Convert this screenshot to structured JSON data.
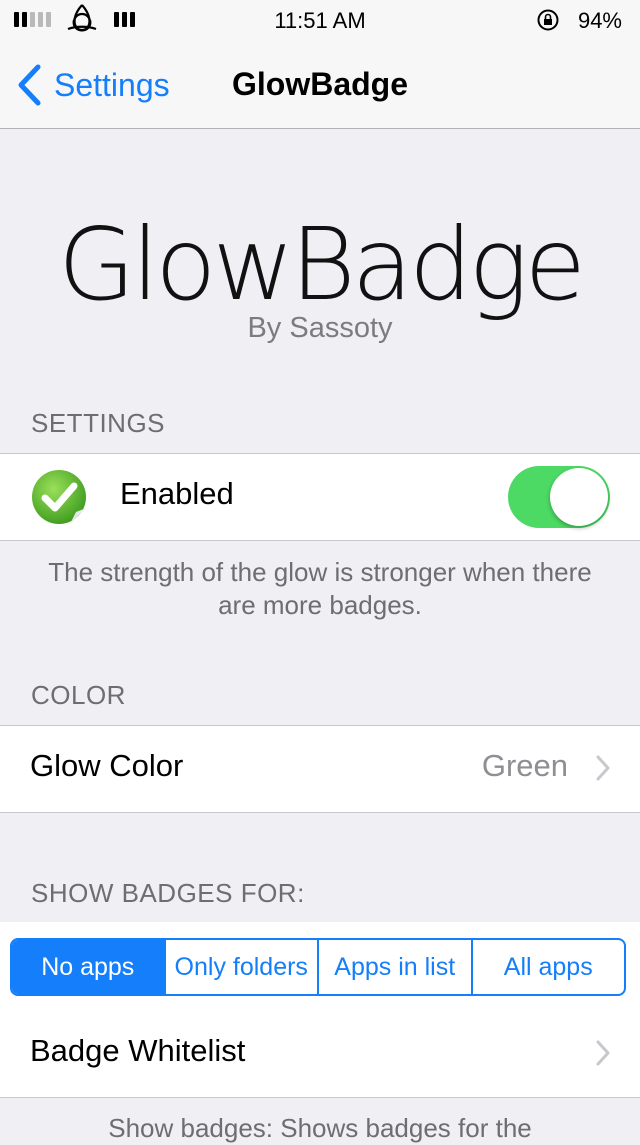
{
  "status_bar": {
    "time": "11:51 AM",
    "battery": "94%"
  },
  "nav": {
    "back_label": "Settings",
    "title": "GlowBadge"
  },
  "hero": {
    "title": "GlowBadge",
    "subtitle": "By Sassoty"
  },
  "sections": {
    "settings_header": "SETTINGS",
    "enabled_label": "Enabled",
    "enabled_on": true,
    "enabled_note": "The strength of the glow is stronger when there are more badges.",
    "color_header": "COLOR",
    "glow_color_label": "Glow Color",
    "glow_color_value": "Green",
    "show_badges_header": "SHOW BADGES FOR:",
    "segments": [
      "No apps",
      "Only folders",
      "Apps in list",
      "All apps"
    ],
    "selected_segment": "No apps",
    "whitelist_label": "Badge Whitelist",
    "footer_partial": "Show badges: Shows badges for the"
  },
  "colors": {
    "accent": "#147efb",
    "toggle_on": "#4cd964",
    "background": "#efeff4"
  }
}
